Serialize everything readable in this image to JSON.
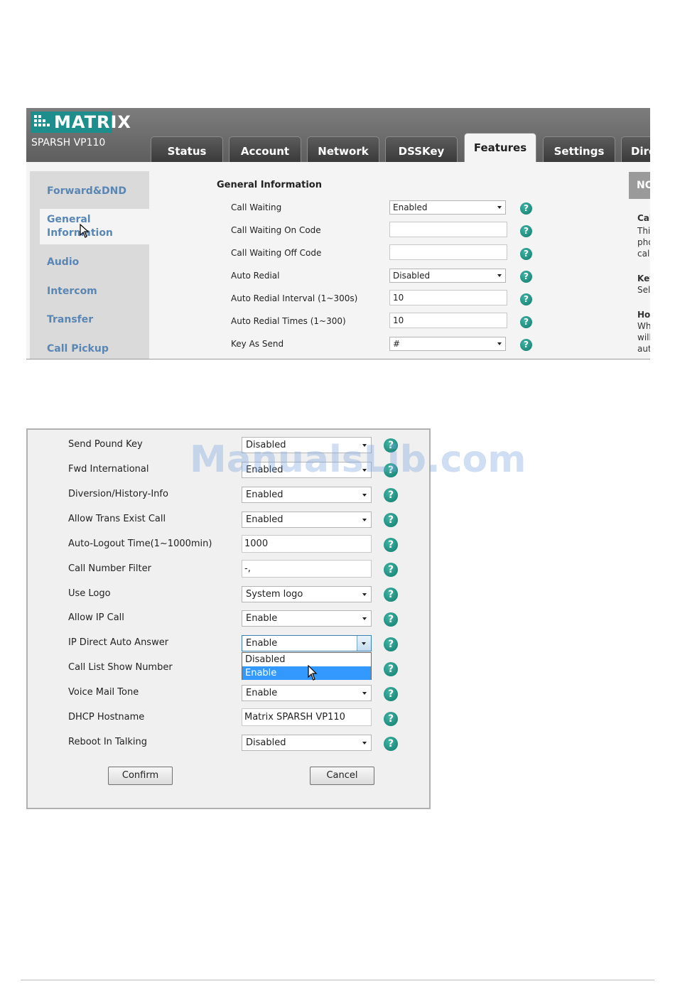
{
  "shot1": {
    "brand": "MATRIX",
    "model": "SPARSH VP110",
    "tabs": [
      {
        "label": "Status"
      },
      {
        "label": "Account"
      },
      {
        "label": "Network"
      },
      {
        "label": "DSSKey"
      },
      {
        "label": "Features",
        "active": true
      },
      {
        "label": "Settings"
      },
      {
        "label": "Dire"
      }
    ],
    "sidebar": [
      {
        "label": "Forward&DND"
      },
      {
        "label": "General Information",
        "active": true
      },
      {
        "label": "Audio"
      },
      {
        "label": "Intercom"
      },
      {
        "label": "Transfer"
      },
      {
        "label": "Call Pickup"
      }
    ],
    "section_title": "General Information",
    "rows": [
      {
        "label": "Call Waiting",
        "type": "select",
        "value": "Enabled"
      },
      {
        "label": "Call Waiting On Code",
        "type": "input",
        "value": ""
      },
      {
        "label": "Call Waiting Off Code",
        "type": "input",
        "value": ""
      },
      {
        "label": "Auto Redial",
        "type": "select",
        "value": "Disabled"
      },
      {
        "label": "Auto Redial Interval (1~300s)",
        "type": "input",
        "value": "10"
      },
      {
        "label": "Auto Redial Times (1~300)",
        "type": "input",
        "value": "10"
      },
      {
        "label": "Key As Send",
        "type": "select",
        "value": "#"
      }
    ],
    "note": {
      "head": "NO",
      "lines": [
        "Cal",
        "Thi",
        "pho",
        "cal",
        "Key",
        "Sel",
        "Ho",
        "Wh",
        "will",
        "aut"
      ]
    },
    "help_glyph": "?"
  },
  "shot2": {
    "rows": [
      {
        "label": "Send Pound Key",
        "type": "select",
        "value": "Disabled"
      },
      {
        "label": "Fwd International",
        "type": "select",
        "value": "Enabled"
      },
      {
        "label": "Diversion/History-Info",
        "type": "select",
        "value": "Enabled"
      },
      {
        "label": "Allow Trans Exist Call",
        "type": "select",
        "value": "Enabled"
      },
      {
        "label": "Auto-Logout Time(1~1000min)",
        "type": "input",
        "value": "1000"
      },
      {
        "label": "Call Number Filter",
        "type": "input",
        "value": "-,"
      },
      {
        "label": "Use Logo",
        "type": "select",
        "value": "System logo"
      },
      {
        "label": "Allow IP Call",
        "type": "select",
        "value": "Enable"
      },
      {
        "label": "IP Direct Auto Answer",
        "type": "select",
        "value": "Enable",
        "open": true
      },
      {
        "label": "Call List Show Number",
        "type": "select",
        "value": ""
      },
      {
        "label": "Voice Mail Tone",
        "type": "select",
        "value": "Enable"
      },
      {
        "label": "DHCP Hostname",
        "type": "input",
        "value": "Matrix SPARSH VP110"
      },
      {
        "label": "Reboot In Talking",
        "type": "select",
        "value": "Disabled"
      }
    ],
    "dropdown_options": [
      "Disabled",
      "Enable"
    ],
    "dropdown_highlighted": "Enable",
    "confirm_label": "Confirm",
    "cancel_label": "Cancel"
  },
  "watermark": "ManualsLib.com"
}
